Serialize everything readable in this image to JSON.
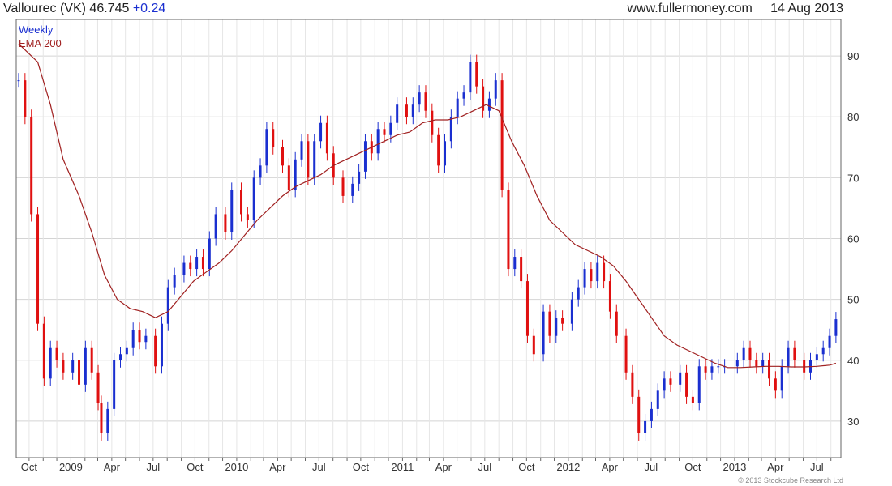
{
  "header": {
    "ticker": "Vallourec (VK)",
    "price": "46.745",
    "change": "+0.24",
    "site": "www.fullermoney.com",
    "date": "14 Aug 2013"
  },
  "legend": {
    "weekly": "Weekly",
    "ema": "EMA 200"
  },
  "copyright": "© 2013 Stockcube Research Ltd",
  "colors": {
    "up": "#1a2fd0",
    "down": "#e01010",
    "ema": "#a02020",
    "grid": "#d4d4d4"
  },
  "chart_data": {
    "type": "candlestick",
    "title": "Vallourec (VK) 46.745 +0.24",
    "ylim": [
      24,
      96
    ],
    "y_ticks": [
      30,
      40,
      50,
      60,
      70,
      80,
      90
    ],
    "x_tick_labels": [
      "Oct",
      "2009",
      "Apr",
      "Jul",
      "Oct",
      "2010",
      "Apr",
      "Jul",
      "Oct",
      "2011",
      "Apr",
      "Jul",
      "Oct",
      "2012",
      "Apr",
      "Jul",
      "Oct",
      "2013",
      "Apr",
      "Jul"
    ],
    "x_start": "2008-09-08",
    "x_end": "2013-08-14",
    "grid": true,
    "series": [
      {
        "name": "Weekly",
        "kind": "close",
        "dates": [
          "2008-09-08",
          "2008-09-22",
          "2008-10-06",
          "2008-10-20",
          "2008-11-03",
          "2008-11-17",
          "2008-12-01",
          "2008-12-15",
          "2009-01-05",
          "2009-01-19",
          "2009-02-02",
          "2009-02-16",
          "2009-03-02",
          "2009-03-09",
          "2009-03-23",
          "2009-04-06",
          "2009-04-20",
          "2009-05-04",
          "2009-05-18",
          "2009-06-01",
          "2009-06-15",
          "2009-07-06",
          "2009-07-20",
          "2009-08-03",
          "2009-08-17",
          "2009-09-07",
          "2009-09-21",
          "2009-10-05",
          "2009-10-19",
          "2009-11-02",
          "2009-11-16",
          "2009-12-07",
          "2009-12-21",
          "2010-01-11",
          "2010-01-25",
          "2010-02-08",
          "2010-02-22",
          "2010-03-08",
          "2010-03-22",
          "2010-04-12",
          "2010-04-26",
          "2010-05-10",
          "2010-05-24",
          "2010-06-07",
          "2010-06-21",
          "2010-07-05",
          "2010-07-19",
          "2010-08-02",
          "2010-08-23",
          "2010-09-13",
          "2010-09-27",
          "2010-10-11",
          "2010-10-25",
          "2010-11-08",
          "2010-11-22",
          "2010-12-06",
          "2010-12-20",
          "2011-01-10",
          "2011-01-24",
          "2011-02-07",
          "2011-02-21",
          "2011-03-07",
          "2011-03-21",
          "2011-04-04",
          "2011-04-18",
          "2011-05-02",
          "2011-05-16",
          "2011-05-30",
          "2011-06-13",
          "2011-06-27",
          "2011-07-11",
          "2011-07-25",
          "2011-08-08",
          "2011-08-22",
          "2011-09-05",
          "2011-09-19",
          "2011-10-03",
          "2011-10-17",
          "2011-11-07",
          "2011-11-21",
          "2011-12-05",
          "2011-12-19",
          "2012-01-09",
          "2012-01-23",
          "2012-02-06",
          "2012-02-20",
          "2012-03-05",
          "2012-03-19",
          "2012-04-02",
          "2012-04-16",
          "2012-05-07",
          "2012-05-21",
          "2012-06-04",
          "2012-06-18",
          "2012-07-02",
          "2012-07-16",
          "2012-07-30",
          "2012-08-13",
          "2012-09-03",
          "2012-09-17",
          "2012-10-01",
          "2012-10-15",
          "2012-10-29",
          "2012-11-12",
          "2012-11-26",
          "2012-12-10",
          "2013-01-07",
          "2013-01-21",
          "2013-02-04",
          "2013-02-18",
          "2013-03-04",
          "2013-03-18",
          "2013-04-01",
          "2013-04-15",
          "2013-04-29",
          "2013-05-13",
          "2013-06-03",
          "2013-06-17",
          "2013-07-01",
          "2013-07-15",
          "2013-07-29",
          "2013-08-12"
        ],
        "values": [
          86,
          80,
          64,
          46,
          37,
          42,
          40,
          38,
          40,
          36,
          42,
          38,
          33,
          28,
          32,
          40,
          41,
          42,
          45,
          43,
          44,
          39,
          46,
          52,
          54,
          56,
          55,
          57,
          55,
          60,
          64,
          61,
          68,
          64,
          63,
          70,
          72,
          78,
          75,
          72,
          68,
          73,
          76,
          70,
          76,
          79,
          74,
          70,
          67,
          69,
          71,
          76,
          74,
          78,
          77,
          79,
          82,
          80,
          82,
          84,
          81,
          77,
          72,
          76,
          80,
          83,
          84,
          89,
          85,
          81,
          83,
          86,
          68,
          55,
          57,
          53,
          44,
          41,
          48,
          44,
          47,
          46,
          50,
          52,
          55,
          53,
          56,
          53,
          48,
          44,
          38,
          34,
          28,
          30,
          32,
          35,
          37,
          36,
          38,
          34,
          33,
          39,
          38,
          39,
          39,
          39,
          40,
          42,
          40,
          39,
          40,
          37,
          35,
          39,
          42,
          40,
          38,
          40,
          41,
          42,
          44,
          46.745
        ]
      },
      {
        "name": "EMA 200",
        "kind": "line",
        "dates": [
          "2008-09-08",
          "2008-10-20",
          "2008-11-17",
          "2008-12-15",
          "2009-01-19",
          "2009-02-16",
          "2009-03-16",
          "2009-04-13",
          "2009-05-11",
          "2009-06-08",
          "2009-07-06",
          "2009-08-03",
          "2009-08-31",
          "2009-09-28",
          "2009-10-26",
          "2009-11-23",
          "2009-12-21",
          "2010-01-18",
          "2010-02-15",
          "2010-03-15",
          "2010-04-12",
          "2010-05-10",
          "2010-06-07",
          "2010-07-05",
          "2010-08-02",
          "2010-08-30",
          "2010-09-27",
          "2010-10-25",
          "2010-11-22",
          "2010-12-20",
          "2011-01-17",
          "2011-02-14",
          "2011-03-14",
          "2011-04-11",
          "2011-05-09",
          "2011-06-06",
          "2011-07-04",
          "2011-08-01",
          "2011-08-29",
          "2011-09-26",
          "2011-10-24",
          "2011-11-21",
          "2011-12-19",
          "2012-01-16",
          "2012-02-13",
          "2012-03-12",
          "2012-04-09",
          "2012-05-07",
          "2012-06-04",
          "2012-07-02",
          "2012-07-30",
          "2012-08-27",
          "2012-09-24",
          "2012-10-22",
          "2012-11-19",
          "2012-12-17",
          "2013-01-14",
          "2013-02-11",
          "2013-03-11",
          "2013-04-08",
          "2013-05-06",
          "2013-06-03",
          "2013-07-01",
          "2013-07-29",
          "2013-08-12"
        ],
        "values": [
          92,
          89,
          82,
          73,
          67,
          61,
          54,
          50,
          48.5,
          48,
          47,
          48,
          50.5,
          53,
          54.5,
          56,
          58,
          60.5,
          63,
          65,
          67,
          68.5,
          69.5,
          70.5,
          72,
          73,
          74,
          75,
          76,
          77,
          77.5,
          79,
          79.5,
          79.5,
          80,
          81,
          82,
          81,
          76,
          72,
          67,
          63,
          61,
          59,
          58,
          57,
          55.5,
          53,
          50,
          47,
          44,
          42.5,
          41.5,
          40.5,
          39.5,
          38.8,
          38.8,
          38.9,
          39,
          39,
          38.9,
          38.9,
          39,
          39.2,
          39.5
        ]
      }
    ]
  }
}
